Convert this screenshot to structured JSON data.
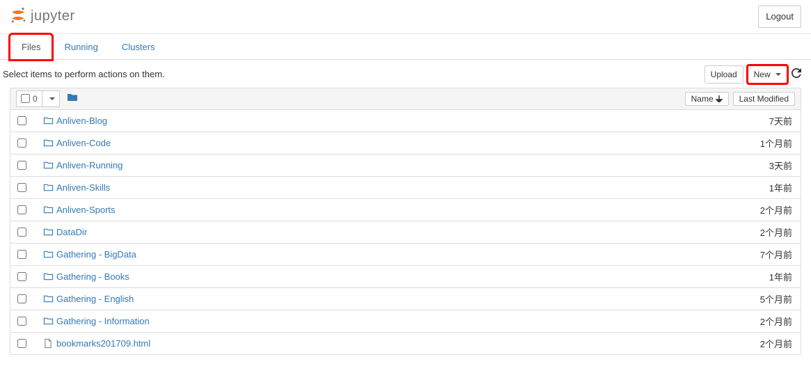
{
  "header": {
    "logo_text": "jupyter",
    "logout_label": "Logout"
  },
  "tabs": {
    "files": "Files",
    "running": "Running",
    "clusters": "Clusters"
  },
  "toolbar": {
    "hint": "Select items to perform actions on them.",
    "upload_label": "Upload",
    "new_label": "New",
    "selected_count": "0",
    "sort_name": "Name",
    "sort_modified": "Last Modified"
  },
  "files": [
    {
      "name": "Anliven-Blog",
      "type": "folder",
      "modified": "7天前"
    },
    {
      "name": "Anliven-Code",
      "type": "folder",
      "modified": "1个月前"
    },
    {
      "name": "Anliven-Running",
      "type": "folder",
      "modified": "3天前"
    },
    {
      "name": "Anliven-Skills",
      "type": "folder",
      "modified": "1年前"
    },
    {
      "name": "Anliven-Sports",
      "type": "folder",
      "modified": "2个月前"
    },
    {
      "name": "DataDir",
      "type": "folder",
      "modified": "2个月前"
    },
    {
      "name": "Gathering - BigData",
      "type": "folder",
      "modified": "7个月前"
    },
    {
      "name": "Gathering - Books",
      "type": "folder",
      "modified": "1年前"
    },
    {
      "name": "Gathering - English",
      "type": "folder",
      "modified": "5个月前"
    },
    {
      "name": "Gathering - Information",
      "type": "folder",
      "modified": "2个月前"
    },
    {
      "name": "bookmarks201709.html",
      "type": "file",
      "modified": "2个月前"
    }
  ]
}
